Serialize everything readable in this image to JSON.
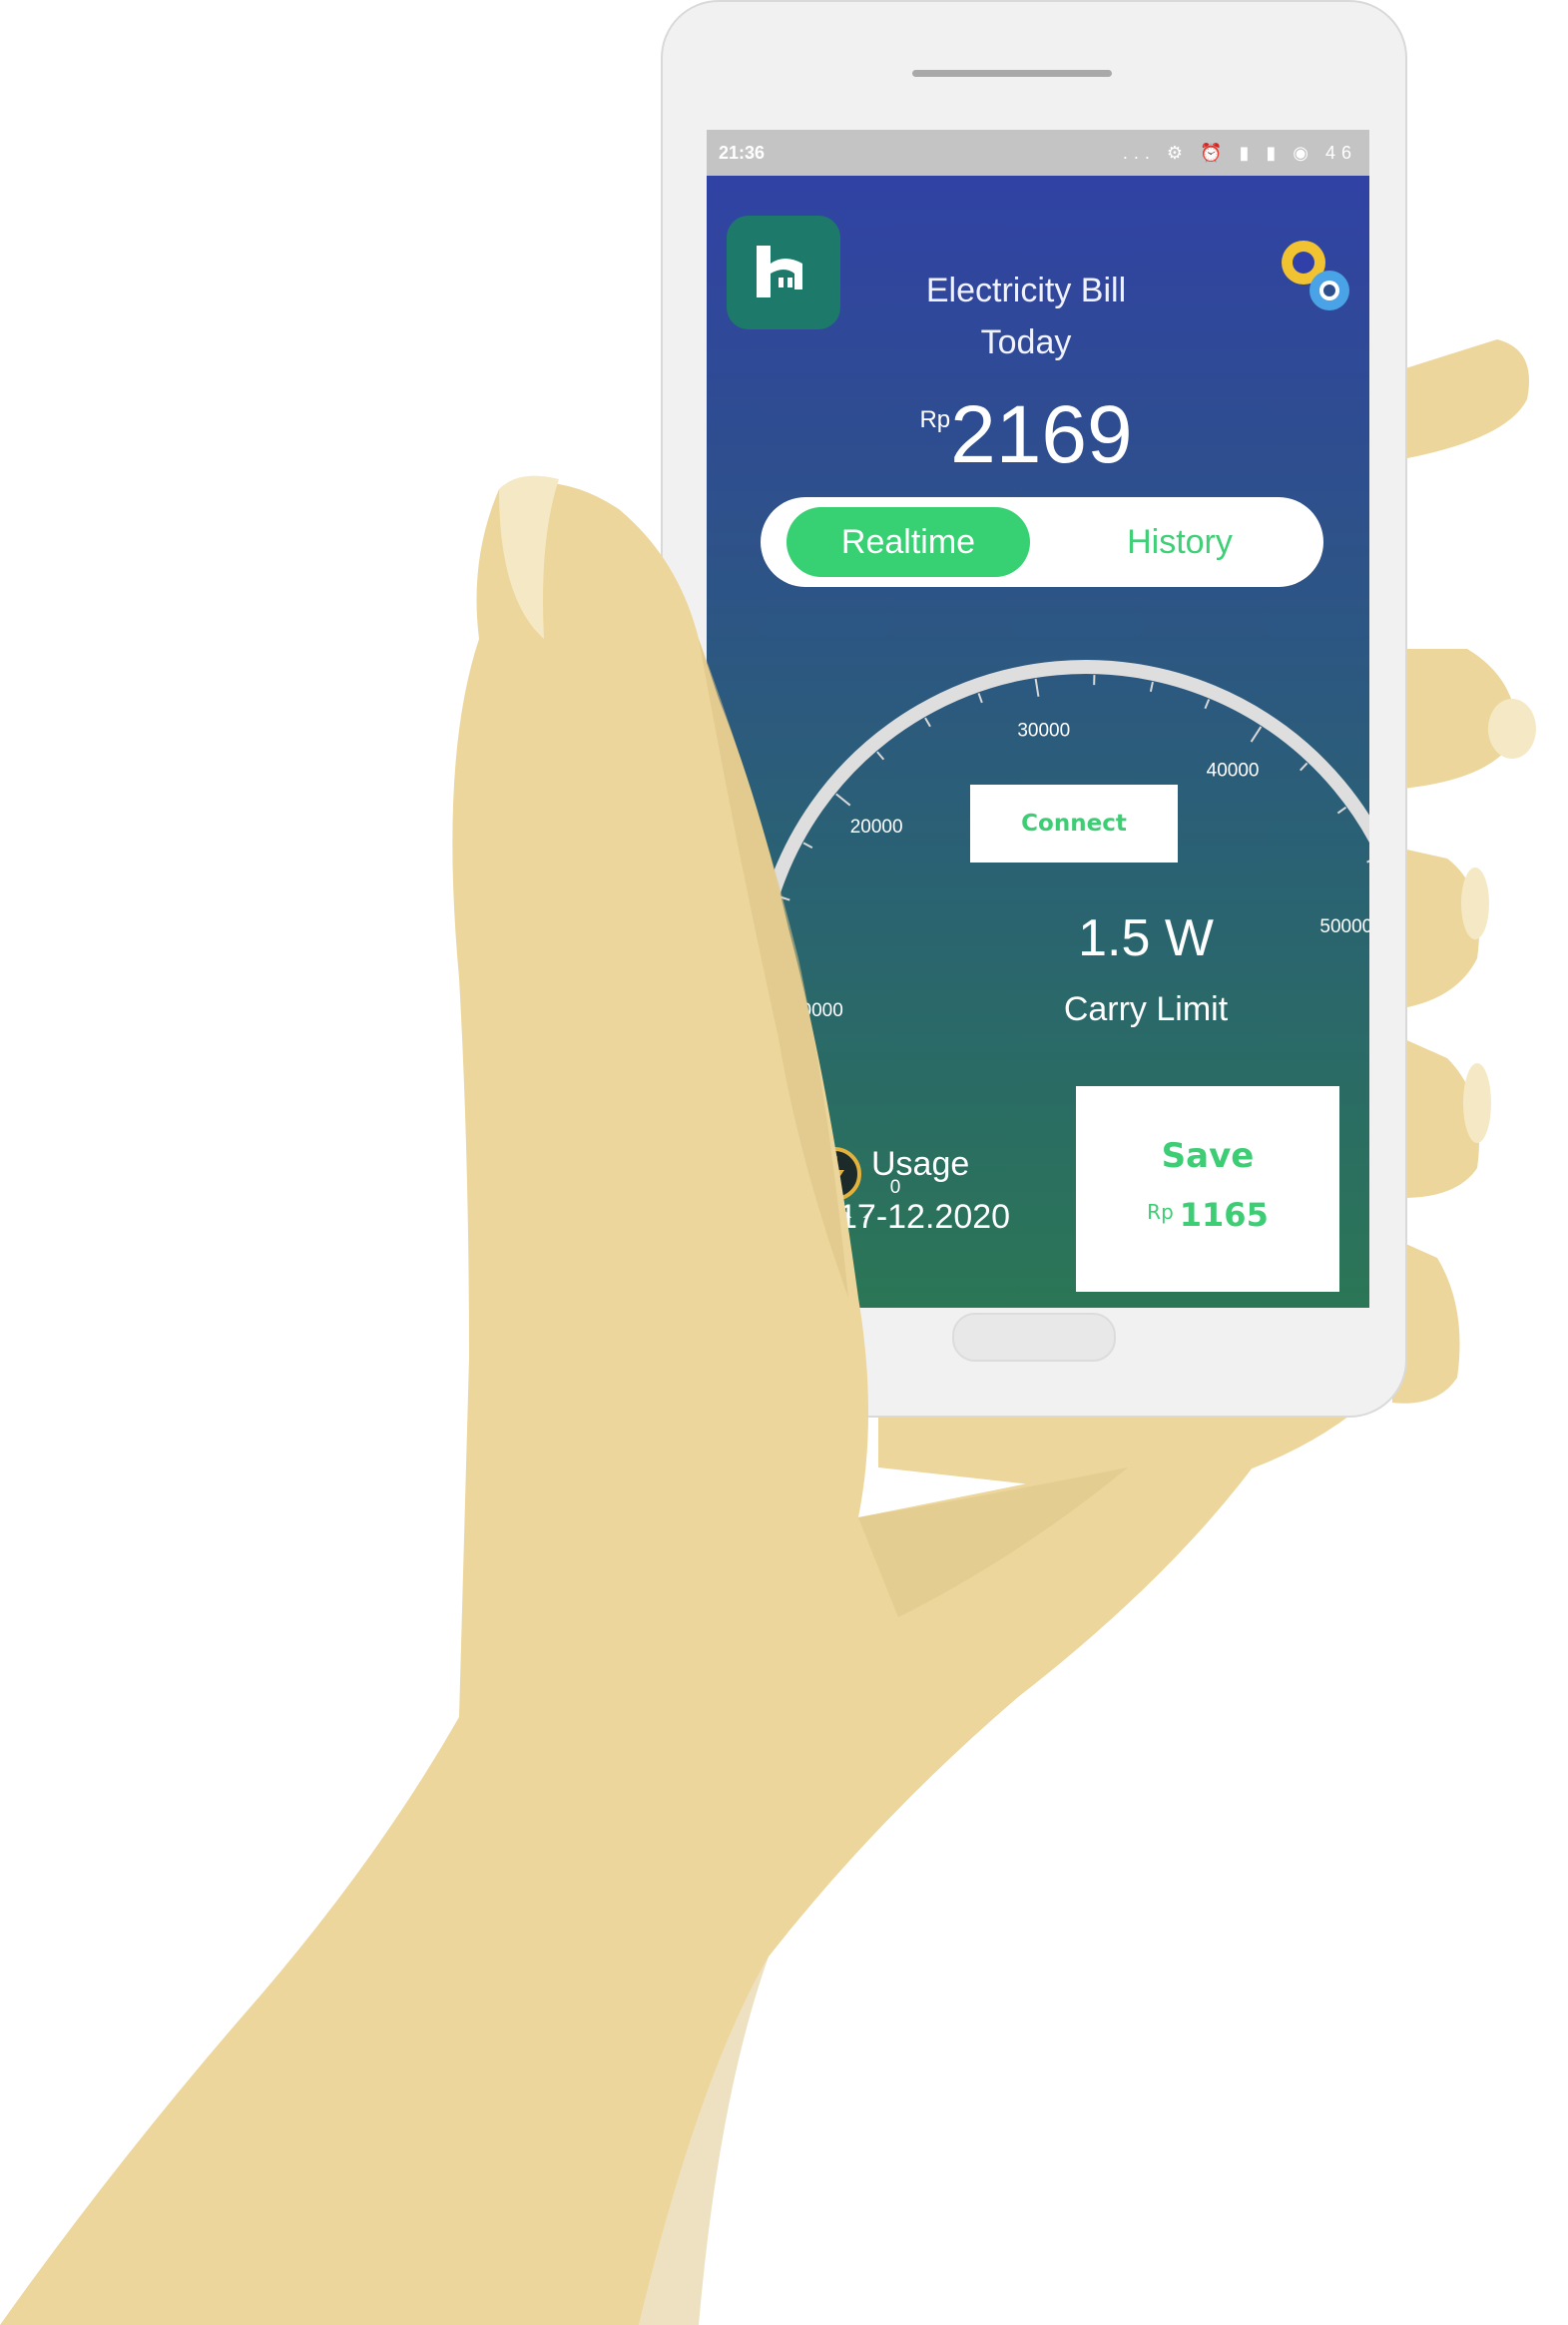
{
  "colors": {
    "hand": "#ecd69b",
    "hand_shadow": "#dcc385",
    "accent_green": "#37d173",
    "screen_top": "#3140a8",
    "screen_bottom": "#2b7656"
  },
  "status_bar": {
    "time": "21:36",
    "icons": "... ⚙ ⏰ ▮ ▮ ◉ 46"
  },
  "header": {
    "app_icon": "home-plug-icon",
    "title_line1": "Electricity Bill",
    "title_line2": "Today",
    "currency": "Rp",
    "amount": "2169",
    "settings_icon": "gears-icon"
  },
  "toggle": {
    "selected": "Realtime",
    "options": [
      "Realtime",
      "History"
    ]
  },
  "gauge": {
    "min": 0,
    "max": 50000,
    "ticks": [
      "0",
      "10000",
      "20000",
      "30000",
      "40000",
      "50000"
    ],
    "connect_label": "Connect",
    "value_text": "1.5 W",
    "value_label": "Carry Limit"
  },
  "usage": {
    "icon": "lightning-icon",
    "label": "Usage",
    "date": "17-12.2020"
  },
  "save": {
    "label": "Save",
    "currency": "Rp",
    "amount": "1165"
  }
}
